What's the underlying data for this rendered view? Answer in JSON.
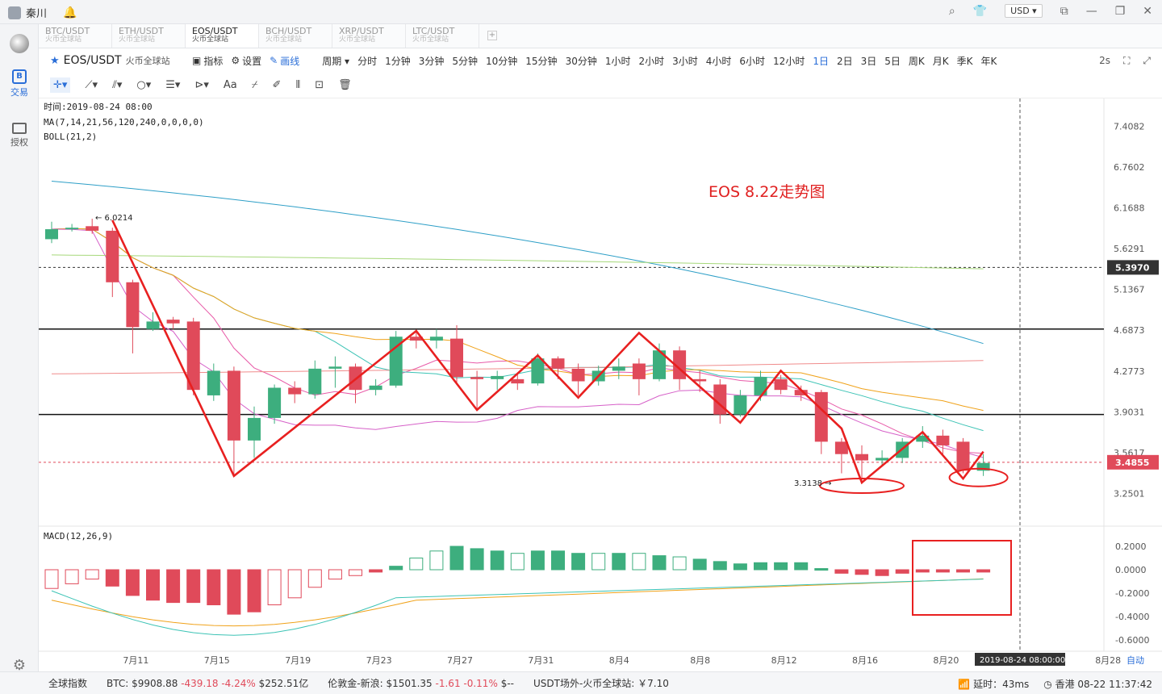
{
  "topbar": {
    "username": "秦川",
    "currency": "USD"
  },
  "sidebar": {
    "trade_label": "交易",
    "auth_label": "授权"
  },
  "tabs": [
    {
      "pair": "BTC/USDT",
      "exchange": "火币全球站"
    },
    {
      "pair": "ETH/USDT",
      "exchange": "火币全球站"
    },
    {
      "pair": "EOS/USDT",
      "exchange": "火币全球站",
      "active": true
    },
    {
      "pair": "BCH/USDT",
      "exchange": "火币全球站"
    },
    {
      "pair": "XRP/USDT",
      "exchange": "火币全球站"
    },
    {
      "pair": "LTC/USDT",
      "exchange": "火币全球站"
    }
  ],
  "toolbar": {
    "symbol": "EOS/USDT",
    "exchange": "火币全球站",
    "indicators": "指标",
    "settings": "设置",
    "draw": "画线",
    "periods": [
      "周期",
      "分时",
      "1分钟",
      "3分钟",
      "5分钟",
      "10分钟",
      "15分钟",
      "30分钟",
      "1小时",
      "2小时",
      "3小时",
      "4小时",
      "6小时",
      "12小时",
      "1日",
      "2日",
      "3日",
      "5日",
      "周K",
      "月K",
      "季K",
      "年K"
    ],
    "active_period": "1日",
    "refresh": "2s"
  },
  "chart_data": {
    "type": "candlestick",
    "legend": {
      "time": "时间:2019-08-24 08:00",
      "ma": "MA(7,14,21,56,120,240,0,0,0,0)",
      "boll": "BOLL(21,2)",
      "macd": "MACD(12,26,9)"
    },
    "annotation": "EOS 8.22走势图",
    "y_ticks": [
      "7.4082",
      "6.7602",
      "6.1688",
      "5.6291",
      "5.1367",
      "4.6873",
      "4.2773",
      "3.9031",
      "3.5617",
      "3.2501"
    ],
    "price_tags": [
      "5.3970",
      "3.4855"
    ],
    "high_label": "6.0214",
    "low_label": "3.3138",
    "macd_ticks": [
      "0.2000",
      "0.0000",
      "-0.2000",
      "-0.4000",
      "-0.6000"
    ],
    "x_ticks": [
      "7月11",
      "7月15",
      "7月19",
      "7月23",
      "7月27",
      "7月31",
      "8月4",
      "8月8",
      "8月12",
      "8月16",
      "8月20",
      "8月28"
    ],
    "crosshair_date": "2019-08-24 08:00:00",
    "corner_labels": [
      "自动"
    ],
    "candles": [
      [
        5.75,
        5.88,
        5.98,
        5.7
      ],
      [
        5.88,
        5.9,
        5.95,
        5.85
      ],
      [
        5.92,
        5.86,
        6.02,
        5.82
      ],
      [
        5.86,
        5.22,
        5.9,
        5.05
      ],
      [
        5.22,
        4.72,
        5.25,
        4.45
      ],
      [
        4.7,
        4.78,
        4.88,
        4.68
      ],
      [
        4.8,
        4.76,
        4.83,
        4.7
      ],
      [
        4.78,
        4.1,
        4.82,
        4.05
      ],
      [
        4.05,
        4.28,
        4.35,
        4.0
      ],
      [
        4.28,
        3.66,
        4.32,
        3.39
      ],
      [
        3.66,
        3.85,
        3.95,
        3.52
      ],
      [
        3.85,
        4.12,
        4.15,
        3.8
      ],
      [
        4.12,
        4.06,
        4.18,
        3.98
      ],
      [
        4.06,
        4.3,
        4.38,
        4.02
      ],
      [
        4.3,
        4.32,
        4.42,
        4.12
      ],
      [
        4.32,
        4.1,
        4.35,
        3.98
      ],
      [
        4.1,
        4.14,
        4.2,
        4.05
      ],
      [
        4.14,
        4.62,
        4.68,
        4.12
      ],
      [
        4.62,
        4.58,
        4.68,
        4.5
      ],
      [
        4.58,
        4.62,
        4.7,
        4.5
      ],
      [
        4.6,
        4.22,
        4.74,
        4.15
      ],
      [
        4.22,
        4.2,
        4.28,
        3.92
      ],
      [
        4.2,
        4.23,
        4.28,
        4.1
      ],
      [
        4.2,
        4.16,
        4.25,
        4.1
      ],
      [
        4.16,
        4.4,
        4.45,
        4.14
      ],
      [
        4.4,
        4.3,
        4.42,
        4.2
      ],
      [
        4.3,
        4.18,
        4.35,
        4.05
      ],
      [
        4.18,
        4.28,
        4.33,
        4.14
      ],
      [
        4.28,
        4.32,
        4.4,
        4.2
      ],
      [
        4.35,
        4.2,
        4.4,
        4.05
      ],
      [
        4.2,
        4.48,
        4.55,
        4.18
      ],
      [
        4.48,
        4.2,
        4.52,
        4.1
      ],
      [
        4.2,
        4.18,
        4.28,
        4.08
      ],
      [
        4.15,
        3.88,
        4.2,
        3.8
      ],
      [
        3.88,
        4.05,
        4.1,
        3.86
      ],
      [
        4.05,
        4.22,
        4.28,
        4.0
      ],
      [
        4.2,
        4.1,
        4.24,
        4.06
      ],
      [
        4.1,
        4.05,
        4.14,
        4.0
      ],
      [
        4.08,
        3.65,
        4.1,
        3.55
      ],
      [
        3.65,
        3.55,
        3.68,
        3.4
      ],
      [
        3.55,
        3.5,
        3.62,
        3.32
      ],
      [
        3.5,
        3.52,
        3.58,
        3.45
      ],
      [
        3.52,
        3.65,
        3.68,
        3.48
      ],
      [
        3.65,
        3.7,
        3.78,
        3.6
      ],
      [
        3.7,
        3.62,
        3.75,
        3.55
      ],
      [
        3.65,
        3.42,
        3.68,
        3.4
      ],
      [
        3.42,
        3.48,
        3.55,
        3.38
      ]
    ],
    "macd_hist": [
      -0.16,
      -0.12,
      -0.08,
      -0.14,
      -0.22,
      -0.26,
      -0.28,
      -0.28,
      -0.3,
      -0.38,
      -0.36,
      -0.3,
      -0.24,
      -0.15,
      -0.08,
      -0.05,
      -0.02,
      0.03,
      0.1,
      0.16,
      0.2,
      0.18,
      0.16,
      0.14,
      0.16,
      0.16,
      0.14,
      0.14,
      0.14,
      0.14,
      0.12,
      0.11,
      0.09,
      0.07,
      0.05,
      0.06,
      0.06,
      0.06,
      0.01,
      -0.03,
      -0.04,
      -0.05,
      -0.03,
      -0.02,
      -0.02,
      -0.02,
      -0.02
    ]
  },
  "status": {
    "index_label": "全球指数",
    "btc": "BTC: $9908.88",
    "btc_change": "-439.18 -4.24%",
    "btc_vol": "$252.51亿",
    "gold": "伦敦金-新浪: $1501.35",
    "gold_change": "-1.61 -0.11%",
    "gold_tail": "$--",
    "usdt": "USDT场外-火币全球站: ￥7.10",
    "latency": "延时：43ms",
    "clock": "香港 08-22 11:37:42"
  },
  "colors": {
    "up": "#3dae7e",
    "down": "#e04a5a",
    "accent": "#2a6ed8",
    "annotation": "#e02020"
  }
}
